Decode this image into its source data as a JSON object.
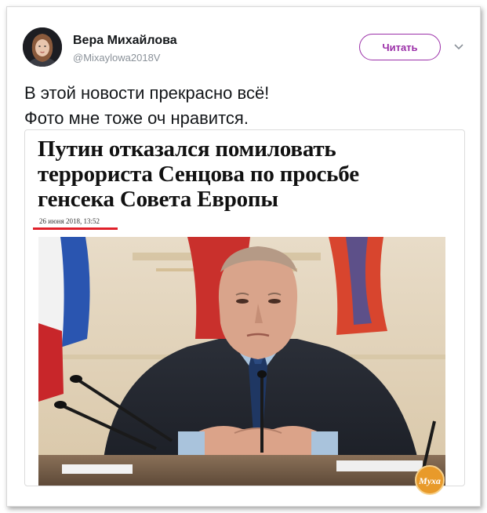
{
  "tweet": {
    "author_name": "Вера Михайлова",
    "author_handle": "@Mixaylowa2018V",
    "follow_label": "Читать",
    "text_lines": [
      "В этой новости прекрасно всё!",
      "Фото мне тоже оч нравится."
    ]
  },
  "article": {
    "headline_lines": [
      "Путин отказался помиловать",
      "террориста Сенцова по просьбе",
      "генсека Совета Европы"
    ],
    "date": "26 июня 2018, 13:52"
  },
  "watermark": {
    "text": "Муха"
  },
  "colors": {
    "follow_accent": "#9b2fa8",
    "date_underline": "#e0202a"
  }
}
